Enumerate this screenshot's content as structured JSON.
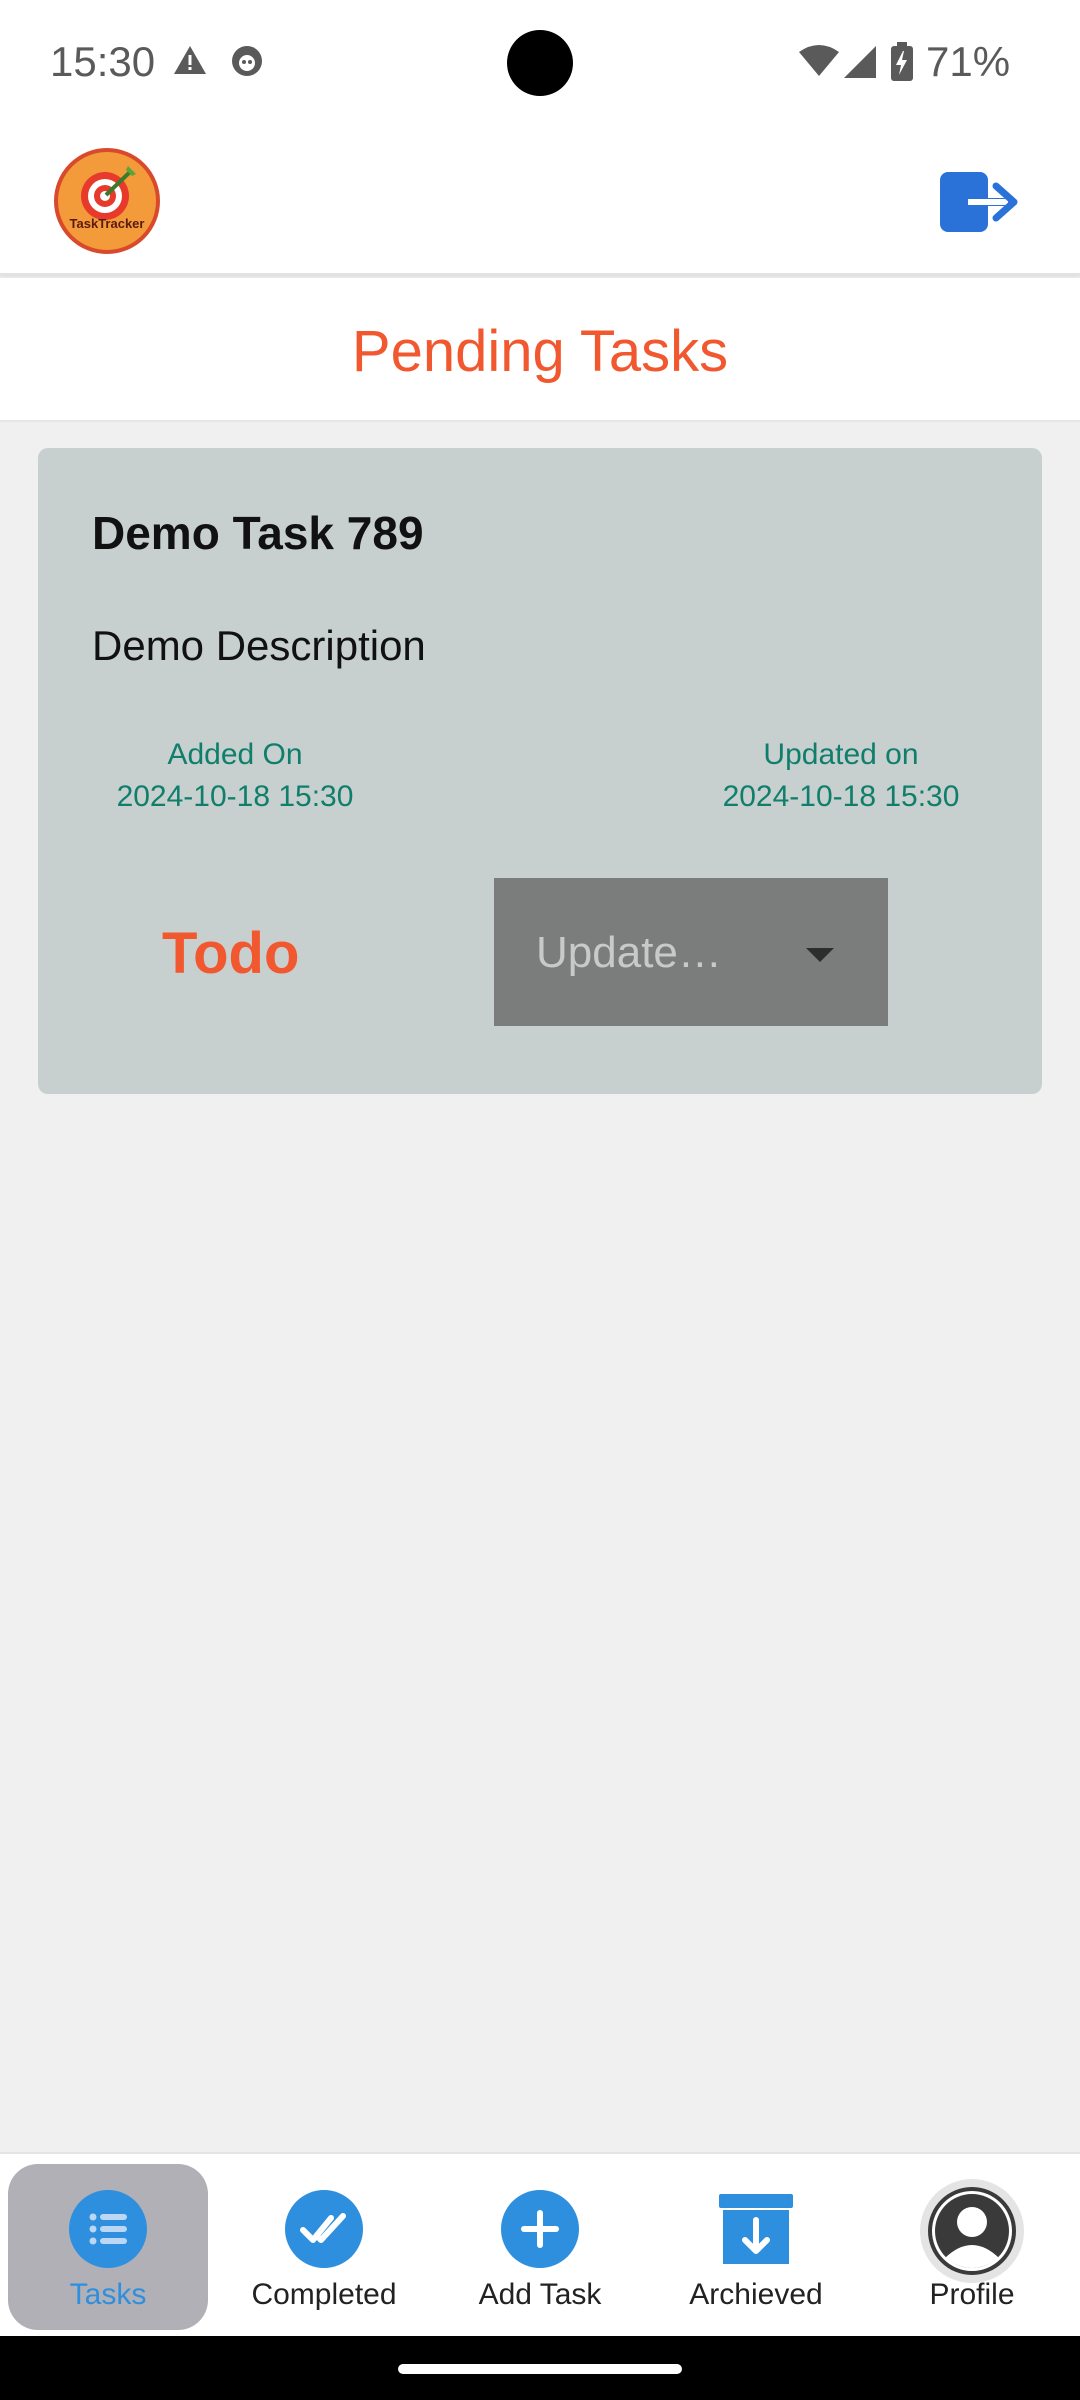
{
  "status_bar": {
    "time": "15:30",
    "battery": "71%",
    "icons": [
      "warning-icon",
      "notification-icon",
      "wifi-icon",
      "signal-icon",
      "battery-icon"
    ]
  },
  "header": {
    "logo_text": "TaskTracker",
    "logout_icon": "logout-icon"
  },
  "page": {
    "title": "Pending Tasks"
  },
  "task": {
    "title": "Demo Task 789",
    "description": "Demo Description",
    "added_label": "Added On",
    "added_value": "2024-10-18 15:30",
    "updated_label": "Updated on",
    "updated_value": "2024-10-18 15:30",
    "status": "Todo",
    "update_placeholder": "Update…"
  },
  "bottom_nav": {
    "items": [
      {
        "label": "Tasks",
        "icon": "list-icon",
        "active": true
      },
      {
        "label": "Completed",
        "icon": "double-check-icon",
        "active": false
      },
      {
        "label": "Add Task",
        "icon": "plus-icon",
        "active": false
      },
      {
        "label": "Archieved",
        "icon": "archive-icon",
        "active": false
      },
      {
        "label": "Profile",
        "icon": "profile-icon",
        "active": false
      }
    ]
  },
  "colors": {
    "accent": "#f2582f",
    "nav_blue": "#2e8fde",
    "date_teal": "#0f7f6c",
    "card_bg": "#c7cfcf"
  }
}
